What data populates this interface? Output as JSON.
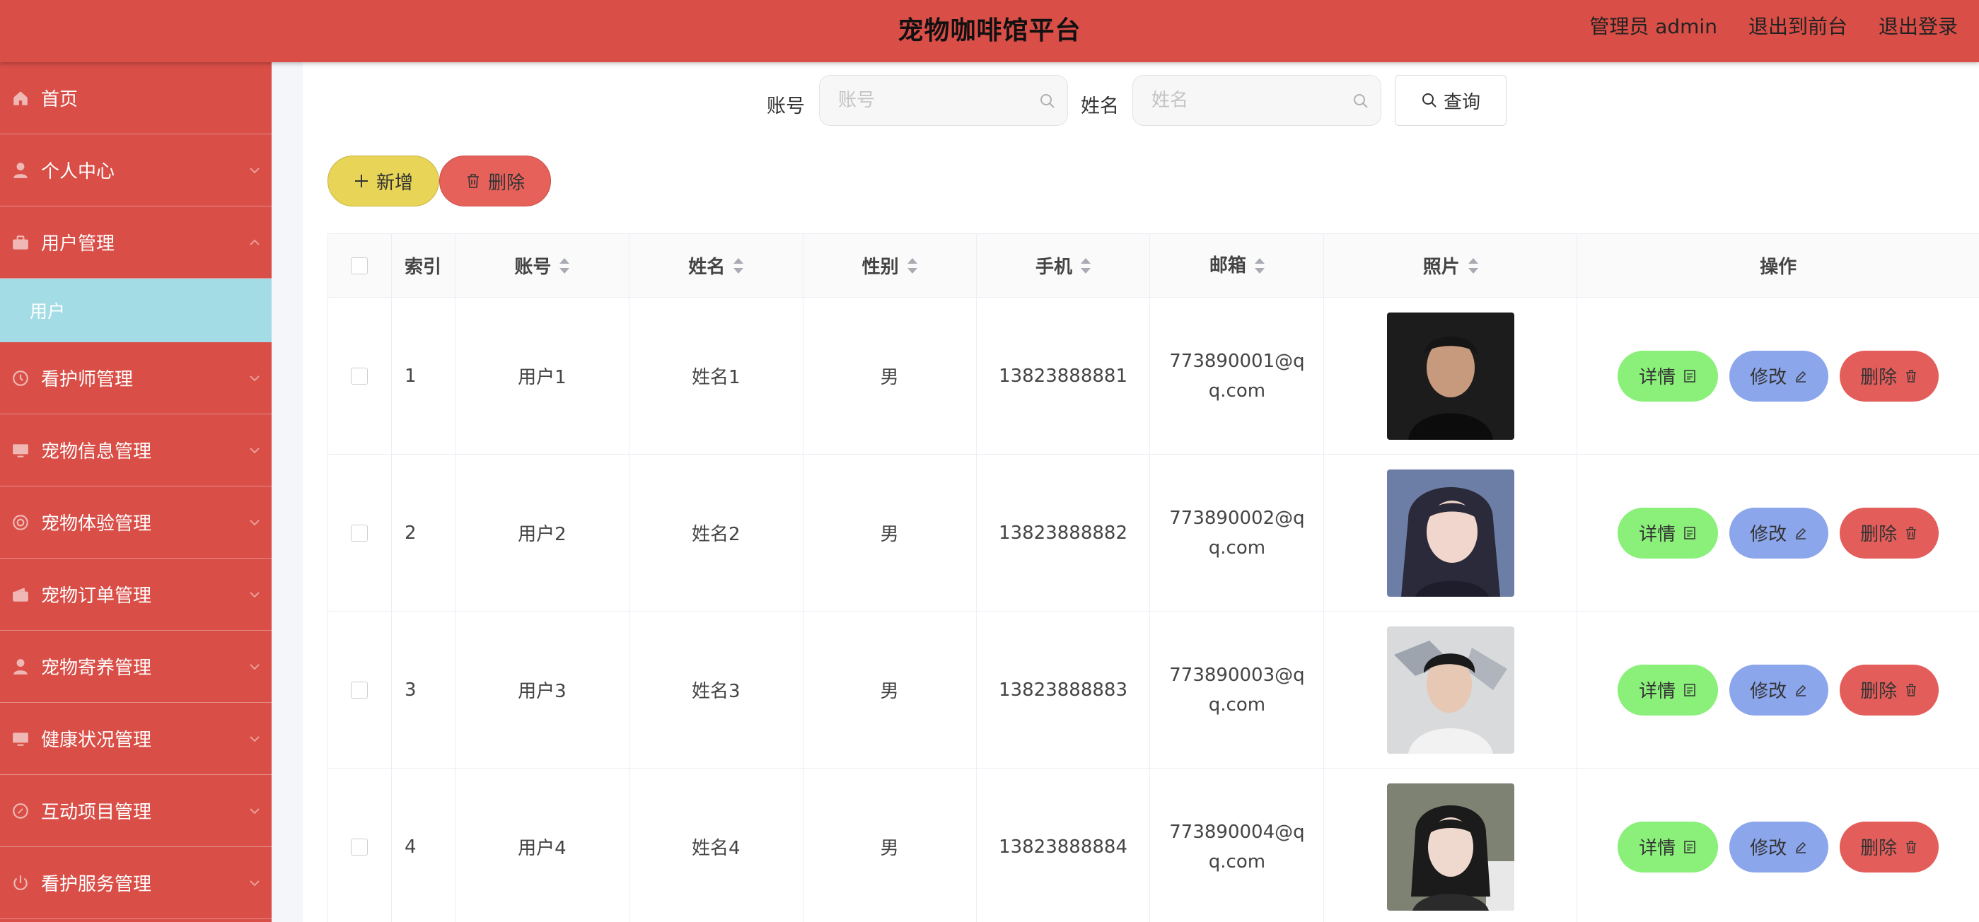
{
  "header": {
    "title": "宠物咖啡馆平台",
    "admin_label": "管理员 admin",
    "back_front": "退出到前台",
    "logout": "退出登录"
  },
  "sidebar": {
    "items": [
      {
        "label": "首页",
        "icon": "home-icon"
      },
      {
        "label": "个人中心",
        "icon": "user-icon"
      },
      {
        "label": "用户管理",
        "icon": "users-icon",
        "expanded": true,
        "sub": "用户"
      },
      {
        "label": "看护师管理",
        "icon": "clock-icon"
      },
      {
        "label": "宠物信息管理",
        "icon": "monitor-icon"
      },
      {
        "label": "宠物体验管理",
        "icon": "target-icon"
      },
      {
        "label": "宠物订单管理",
        "icon": "wallet-icon"
      },
      {
        "label": "宠物寄养管理",
        "icon": "user-icon"
      },
      {
        "label": "健康状况管理",
        "icon": "monitor-icon"
      },
      {
        "label": "互动项目管理",
        "icon": "compass-icon"
      },
      {
        "label": "看护服务管理",
        "icon": "power-icon"
      }
    ]
  },
  "search": {
    "account_label": "账号",
    "account_placeholder": "账号",
    "name_label": "姓名",
    "name_placeholder": "姓名",
    "query_button": "查询"
  },
  "actions": {
    "add": "新增",
    "delete": "删除"
  },
  "table": {
    "headers": {
      "index": "索引",
      "account": "账号",
      "name": "姓名",
      "gender": "性别",
      "phone": "手机",
      "email": "邮箱",
      "photo": "照片",
      "ops": "操作"
    },
    "rows": [
      {
        "index": "1",
        "account": "用户1",
        "name": "姓名1",
        "gender": "男",
        "phone": "13823888881",
        "email": "773890001@qq.com"
      },
      {
        "index": "2",
        "account": "用户2",
        "name": "姓名2",
        "gender": "男",
        "phone": "13823888882",
        "email": "773890002@qq.com"
      },
      {
        "index": "3",
        "account": "用户3",
        "name": "姓名3",
        "gender": "男",
        "phone": "13823888883",
        "email": "773890003@qq.com"
      },
      {
        "index": "4",
        "account": "用户4",
        "name": "姓名4",
        "gender": "男",
        "phone": "13823888884",
        "email": "773890004@qq.com"
      }
    ],
    "op_labels": {
      "detail": "详情",
      "edit": "修改",
      "delete": "删除"
    }
  },
  "colors": {
    "brand": "#d94e47",
    "submenu_active": "#a3dce5",
    "add_button": "#e8d457",
    "delete_button": "#e7615b",
    "detail_button": "#8af07a",
    "edit_button": "#8ca6ec"
  }
}
